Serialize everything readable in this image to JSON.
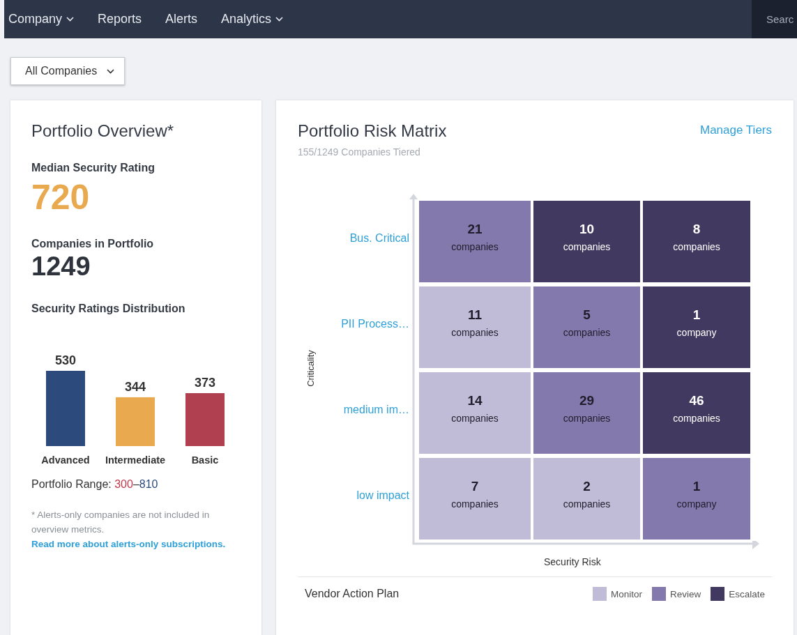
{
  "nav": {
    "items": [
      {
        "label": "Company",
        "dropdown": true
      },
      {
        "label": "Reports",
        "dropdown": false
      },
      {
        "label": "Alerts",
        "dropdown": false
      },
      {
        "label": "Analytics",
        "dropdown": true
      }
    ],
    "search": {
      "placeholder": "Searc"
    }
  },
  "filter": {
    "value": "All Companies"
  },
  "overview": {
    "title": "Portfolio Overview*",
    "median_label": "Median Security Rating",
    "median_value": "720",
    "count_label": "Companies in Portfolio",
    "count_value": "1249",
    "distribution_label": "Security Ratings Distribution",
    "chart_data": {
      "type": "bar",
      "categories": [
        "Advanced",
        "Intermediate",
        "Basic"
      ],
      "stacked": true,
      "series": [
        {
          "color": "#2c4a7c",
          "values": [
            530,
            null,
            null
          ]
        },
        {
          "color": "#e8a94f",
          "values": [
            null,
            344,
            null
          ]
        },
        {
          "color": "#b03f50",
          "values": [
            null,
            null,
            373
          ]
        }
      ],
      "data_labels": true
    },
    "range": {
      "label": "Portfolio Range:",
      "min": "300",
      "separator": "–",
      "max": "810"
    },
    "note": "* Alerts-only companies are not included in overview metrics.",
    "note_link": "Read more about alerts-only subscriptions."
  },
  "matrix": {
    "title": "Portfolio Risk Matrix",
    "subtitle": "155/1249 Companies Tiered",
    "action": "Manage Tiers",
    "y_label": "Criticality",
    "x_label": "Security Risk",
    "rows": [
      {
        "label": "Bus. Critical",
        "cells": [
          {
            "count": "21",
            "unit": "companies",
            "color": "#8479ad"
          },
          {
            "count": "10",
            "unit": "companies",
            "color": "#41395f"
          },
          {
            "count": "8",
            "unit": "companies",
            "color": "#41395f"
          }
        ]
      },
      {
        "label": "PII Process…",
        "cells": [
          {
            "count": "11",
            "unit": "companies",
            "color": "#c0bcd8"
          },
          {
            "count": "5",
            "unit": "companies",
            "color": "#8479ad"
          },
          {
            "count": "1",
            "unit": "company",
            "color": "#41395f"
          }
        ]
      },
      {
        "label": "medium im…",
        "cells": [
          {
            "count": "14",
            "unit": "companies",
            "color": "#c0bcd8"
          },
          {
            "count": "29",
            "unit": "companies",
            "color": "#8479ad"
          },
          {
            "count": "46",
            "unit": "companies",
            "color": "#41395f"
          }
        ]
      },
      {
        "label": "low impact",
        "cells": [
          {
            "count": "7",
            "unit": "companies",
            "color": "#c0bcd8"
          },
          {
            "count": "2",
            "unit": "companies",
            "color": "#c0bcd8"
          },
          {
            "count": "1",
            "unit": "company",
            "color": "#8479ad"
          }
        ]
      }
    ],
    "legend_title": "Vendor Action Plan",
    "legend": [
      {
        "label": "Monitor",
        "color": "#c0bcd8"
      },
      {
        "label": "Review",
        "color": "#8479ad"
      },
      {
        "label": "Escalate",
        "color": "#41395f"
      }
    ]
  }
}
